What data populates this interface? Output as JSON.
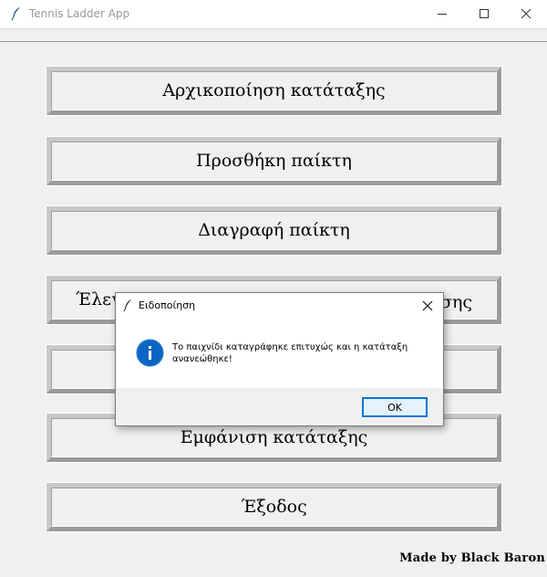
{
  "window": {
    "title": "Tennis Ladder App",
    "controls": [
      "minimize-icon",
      "maximize-icon",
      "close-icon"
    ]
  },
  "main": {
    "buttons": [
      {
        "label": "Αρχικοποίηση κατάταξης"
      },
      {
        "label": "Προσθήκη παίκτη"
      },
      {
        "label": "Διαγραφή παίκτη"
      },
      {
        "label": "Έλεγχος"
      },
      {
        "label": ""
      },
      {
        "label": "Εμφάνιση κατάταξης"
      },
      {
        "label": "Έξοδος"
      }
    ],
    "partial_text_right": "σης",
    "credit": "Made by Black Baron"
  },
  "dialog": {
    "title": "Ειδοποίηση",
    "icon": "info-icon",
    "message": "Το παιχνίδι καταγράφηκε επιτυχώς και η κατάταξη ανανεώθηκε!",
    "ok_label": "OK",
    "accent": "#0078d7"
  }
}
